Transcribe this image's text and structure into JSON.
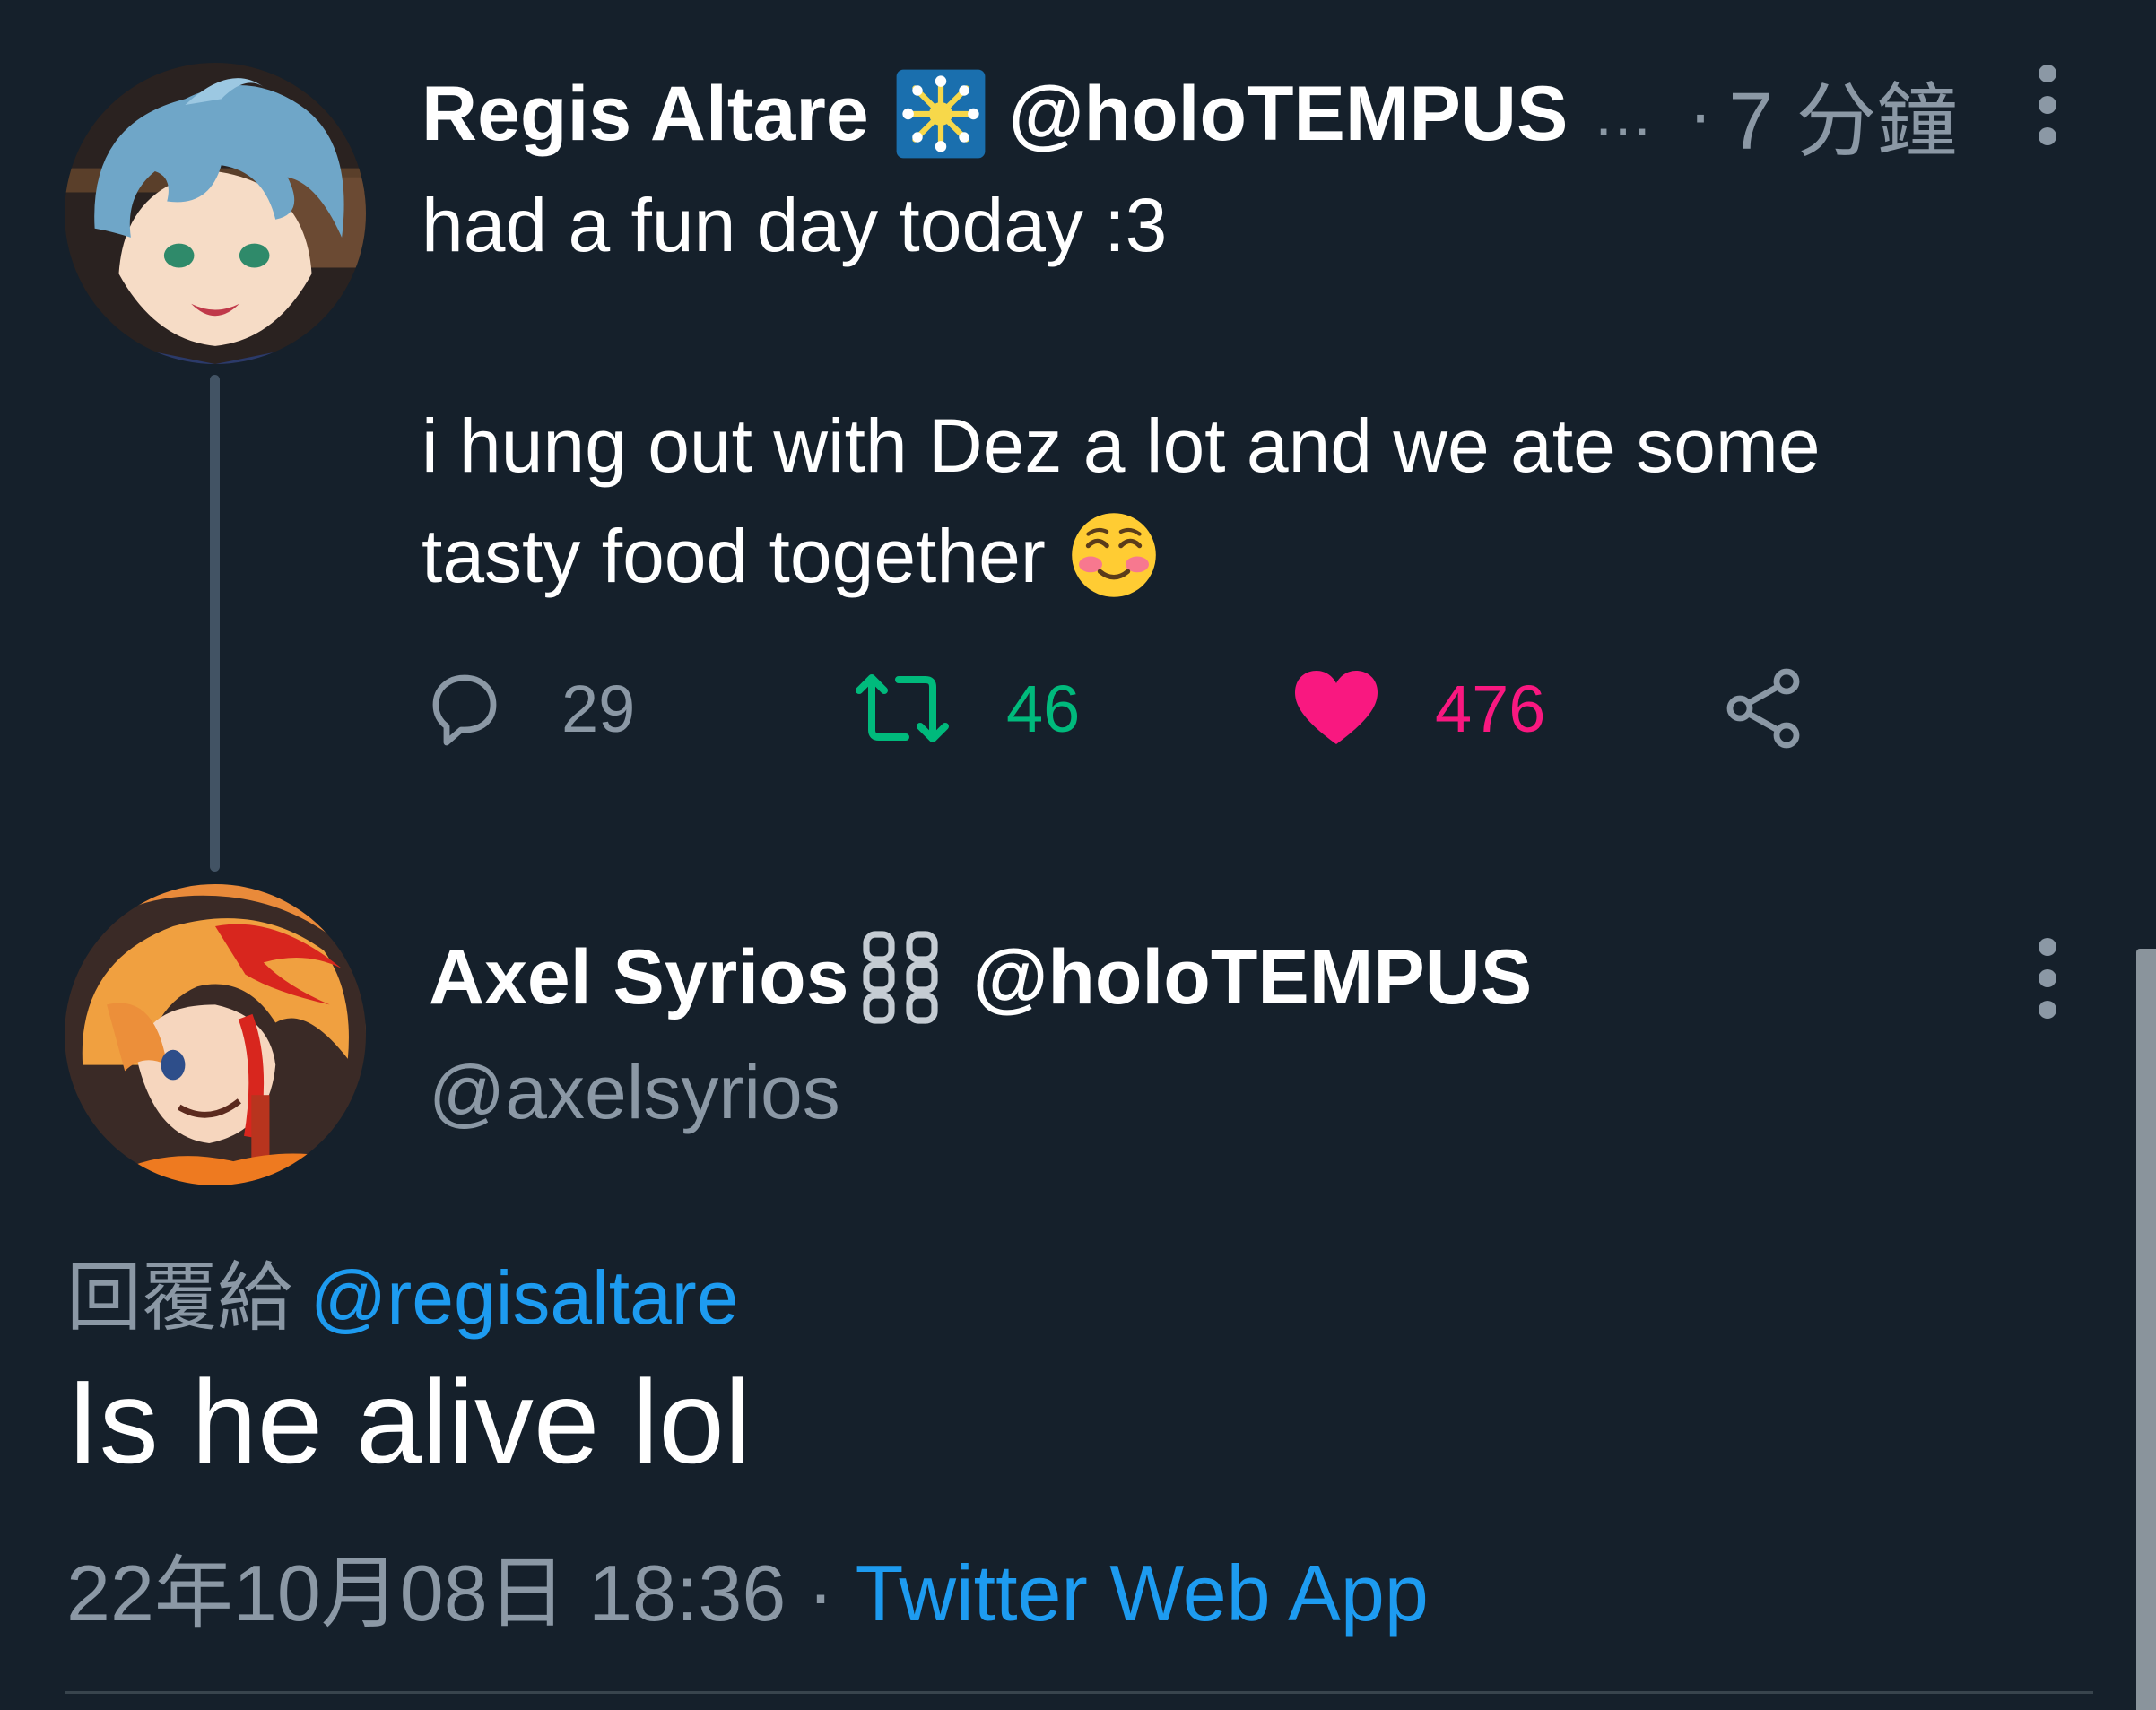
{
  "tweet": {
    "author": "Regis Altare",
    "badge_icon": "affiliate-badge-icon",
    "handle": "@holoTEMPUS",
    "ellipsis": "...",
    "separator": "·",
    "time": "7 分鐘",
    "text_line1": "had a fun day today :3",
    "text_line2": "i hung out with Dez a lot and we ate some tasty food together",
    "emoji": "smiling-face-with-blush-emoji",
    "counts": {
      "replies": "29",
      "retweets": "46",
      "likes": "476"
    },
    "colors": {
      "retweet": "#00ba7c",
      "like": "#f91880"
    }
  },
  "reply": {
    "author": "Axel Syrios",
    "badge_icon": "chain-icon",
    "affiliation": "@holoTEMPUS",
    "handle": "@axelsyrios",
    "reply_prefix": "回覆給",
    "reply_mention": "@regisaltare",
    "text": "Is he alive lol",
    "datetime": "22年10月08日 18:36",
    "separator": "·",
    "source": "Twitter Web App"
  },
  "theme": {
    "background": "#15202b",
    "secondary_text": "#8b98a5",
    "link": "#1d9bf0"
  }
}
